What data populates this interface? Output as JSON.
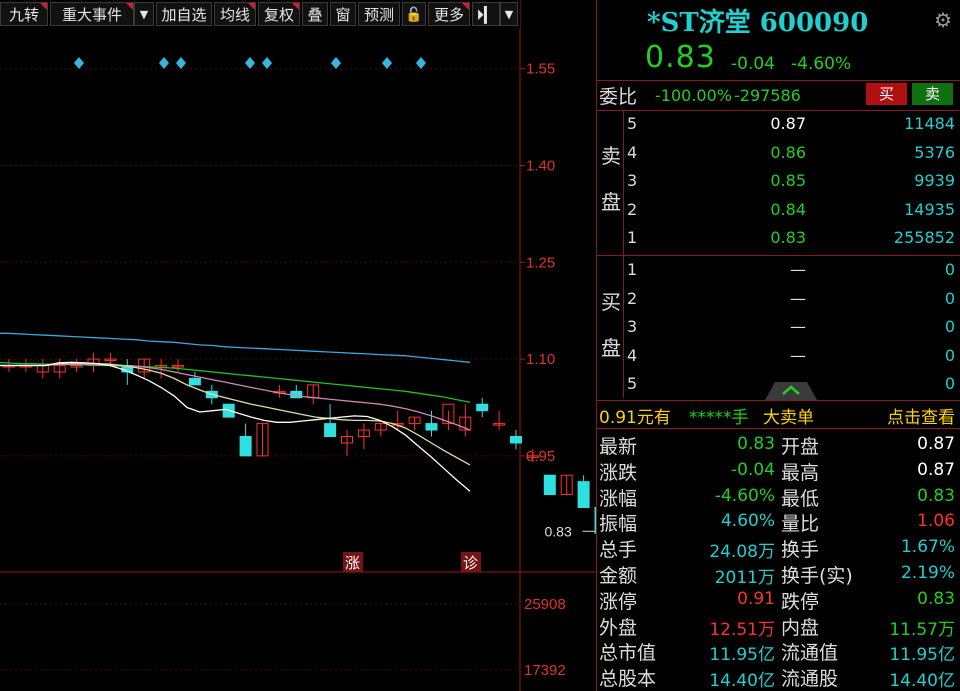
{
  "toolbar": {
    "items": [
      "九转",
      "重大事件",
      "▼",
      "加自选",
      "均线",
      "复权",
      "叠",
      "窗",
      "预测",
      "🔓",
      "更多",
      "⏵▎",
      "▼"
    ]
  },
  "chart": {
    "price_axis": [
      "1.55",
      "1.40",
      "1.25",
      "1.10",
      "0.95"
    ],
    "volume_axis": [
      "25908",
      "17392"
    ],
    "last_price_label": "0.83",
    "badge_up": "涨",
    "badge_diag": "诊"
  },
  "chart_data": {
    "type": "candlestick",
    "ylim": [
      0.77,
      1.61
    ],
    "candles": [
      {
        "o": 1.09,
        "h": 1.1,
        "l": 1.08,
        "c": 1.09
      },
      {
        "o": 1.09,
        "h": 1.1,
        "l": 1.08,
        "c": 1.09
      },
      {
        "o": 1.08,
        "h": 1.1,
        "l": 1.07,
        "c": 1.09
      },
      {
        "o": 1.08,
        "h": 1.1,
        "l": 1.07,
        "c": 1.09
      },
      {
        "o": 1.09,
        "h": 1.1,
        "l": 1.08,
        "c": 1.09
      },
      {
        "o": 1.09,
        "h": 1.11,
        "l": 1.08,
        "c": 1.1
      },
      {
        "o": 1.1,
        "h": 1.11,
        "l": 1.09,
        "c": 1.1
      },
      {
        "o": 1.09,
        "h": 1.1,
        "l": 1.06,
        "c": 1.08
      },
      {
        "o": 1.08,
        "h": 1.1,
        "l": 1.07,
        "c": 1.1
      },
      {
        "o": 1.09,
        "h": 1.1,
        "l": 1.07,
        "c": 1.09
      },
      {
        "o": 1.09,
        "h": 1.1,
        "l": 1.08,
        "c": 1.09
      },
      {
        "o": 1.07,
        "h": 1.08,
        "l": 1.06,
        "c": 1.06
      },
      {
        "o": 1.05,
        "h": 1.06,
        "l": 1.03,
        "c": 1.04
      },
      {
        "o": 1.03,
        "h": 1.03,
        "l": 1.01,
        "c": 1.01
      },
      {
        "o": 0.98,
        "h": 1.0,
        "l": 0.95,
        "c": 0.95
      },
      {
        "o": 0.95,
        "h": 1.0,
        "l": 0.95,
        "c": 1.0
      },
      {
        "o": 1.05,
        "h": 1.06,
        "l": 1.04,
        "c": 1.05
      },
      {
        "o": 1.05,
        "h": 1.06,
        "l": 1.04,
        "c": 1.04
      },
      {
        "o": 1.04,
        "h": 1.06,
        "l": 1.03,
        "c": 1.06
      },
      {
        "o": 1.0,
        "h": 1.03,
        "l": 0.98,
        "c": 0.98
      },
      {
        "o": 0.97,
        "h": 0.99,
        "l": 0.95,
        "c": 0.98
      },
      {
        "o": 0.98,
        "h": 1.0,
        "l": 0.96,
        "c": 0.99
      },
      {
        "o": 0.99,
        "h": 1.0,
        "l": 0.98,
        "c": 1.0
      },
      {
        "o": 1.0,
        "h": 1.02,
        "l": 0.99,
        "c": 1.0
      },
      {
        "o": 1.0,
        "h": 1.01,
        "l": 0.99,
        "c": 1.01
      },
      {
        "o": 1.0,
        "h": 1.02,
        "l": 0.98,
        "c": 0.99
      },
      {
        "o": 1.0,
        "h": 1.02,
        "l": 0.99,
        "c": 1.03
      },
      {
        "o": 0.99,
        "h": 1.03,
        "l": 0.98,
        "c": 1.01
      },
      {
        "o": 1.03,
        "h": 1.04,
        "l": 1.01,
        "c": 1.02
      },
      {
        "o": 1.0,
        "h": 1.02,
        "l": 0.99,
        "c": 1.0
      },
      {
        "o": 0.98,
        "h": 0.99,
        "l": 0.96,
        "c": 0.97
      },
      {
        "o": 0.95,
        "h": 0.96,
        "l": 0.94,
        "c": 0.95
      },
      {
        "o": 0.92,
        "h": 0.92,
        "l": 0.89,
        "c": 0.89
      },
      {
        "o": 0.89,
        "h": 0.92,
        "l": 0.89,
        "c": 0.92
      },
      {
        "o": 0.91,
        "h": 0.92,
        "l": 0.87,
        "c": 0.87
      },
      {
        "o": 0.87,
        "h": 0.87,
        "l": 0.83,
        "c": 0.83
      }
    ],
    "ma": [
      {
        "color": "#3aa7e0",
        "values": [
          1.14,
          1.14,
          1.139,
          1.138,
          1.137,
          1.136,
          1.135,
          1.134,
          1.133,
          1.132,
          1.131,
          1.13,
          1.128,
          1.127,
          1.126,
          1.124,
          1.122,
          1.121,
          1.119,
          1.118,
          1.117,
          1.116,
          1.115,
          1.114,
          1.113,
          1.112,
          1.111,
          1.11,
          1.109,
          1.108,
          1.107,
          1.106,
          1.105,
          1.103,
          1.101,
          1.099,
          1.097,
          1.095
        ]
      },
      {
        "color": "#20c020",
        "values": [
          1.095,
          1.094,
          1.093,
          1.093,
          1.092,
          1.092,
          1.091,
          1.091,
          1.09,
          1.09,
          1.089,
          1.089,
          1.088,
          1.087,
          1.086,
          1.084,
          1.082,
          1.08,
          1.078,
          1.076,
          1.074,
          1.072,
          1.07,
          1.068,
          1.066,
          1.064,
          1.062,
          1.06,
          1.058,
          1.056,
          1.054,
          1.052,
          1.05,
          1.047,
          1.044,
          1.041,
          1.037,
          1.033
        ]
      },
      {
        "color": "#d087b8",
        "values": [
          1.09,
          1.09,
          1.09,
          1.09,
          1.09,
          1.092,
          1.092,
          1.092,
          1.091,
          1.09,
          1.09,
          1.089,
          1.087,
          1.084,
          1.08,
          1.076,
          1.072,
          1.068,
          1.064,
          1.06,
          1.056,
          1.052,
          1.048,
          1.045,
          1.042,
          1.04,
          1.038,
          1.036,
          1.034,
          1.032,
          1.03,
          1.027,
          1.023,
          1.018,
          1.012,
          1.005,
          0.998,
          0.99
        ]
      },
      {
        "color": "#e0e0a0",
        "values": [
          1.09,
          1.09,
          1.09,
          1.09,
          1.09,
          1.093,
          1.094,
          1.094,
          1.093,
          1.092,
          1.09,
          1.087,
          1.083,
          1.078,
          1.07,
          1.06,
          1.052,
          1.045,
          1.04,
          1.035,
          1.03,
          1.026,
          1.022,
          1.018,
          1.014,
          1.01,
          1.008,
          1.006,
          1.005,
          1.005,
          1.004,
          1.0,
          0.993,
          0.982,
          0.97,
          0.958,
          0.947,
          0.936
        ]
      },
      {
        "color": "#ffffff",
        "values": [
          1.09,
          1.09,
          1.09,
          1.09,
          1.09,
          1.094,
          1.095,
          1.094,
          1.093,
          1.09,
          1.084,
          1.076,
          1.067,
          1.056,
          1.043,
          1.025,
          1.018,
          1.02,
          1.022,
          1.016,
          1.01,
          1.005,
          1.002,
          1.002,
          1.004,
          1.006,
          1.008,
          1.01,
          1.012,
          1.011,
          1.005,
          0.995,
          0.982,
          0.965,
          0.948,
          0.93,
          0.912,
          0.895
        ]
      }
    ],
    "volume_ylim": [
      0,
      30000
    ]
  },
  "panel": {
    "stock_name": "*ST济堂 600090",
    "price": "0.83",
    "change": "-0.04",
    "change_pct": "-4.60%",
    "webi_label": "委比",
    "webi_value": "-100.00%",
    "webi_diff": "-297586",
    "buy_label": "买",
    "sell_label": "卖",
    "sell_label_vertical": [
      "卖",
      "盘"
    ],
    "buy_label_vertical": [
      "买",
      "盘"
    ],
    "asks": [
      {
        "level": "5",
        "price": "0.87",
        "vol": "11484"
      },
      {
        "level": "4",
        "price": "0.86",
        "vol": "5376"
      },
      {
        "level": "3",
        "price": "0.85",
        "vol": "9939"
      },
      {
        "level": "2",
        "price": "0.84",
        "vol": "14935"
      },
      {
        "level": "1",
        "price": "0.83",
        "vol": "255852"
      }
    ],
    "bids": [
      {
        "level": "1",
        "price": "—",
        "vol": "0"
      },
      {
        "level": "2",
        "price": "—",
        "vol": "0"
      },
      {
        "level": "3",
        "price": "—",
        "vol": "0"
      },
      {
        "level": "4",
        "price": "—",
        "vol": "0"
      },
      {
        "level": "5",
        "price": "—",
        "vol": "0"
      }
    ],
    "tape": {
      "a": "0.91元有",
      "b": "*****手",
      "c": "大卖单",
      "d": "点击查看"
    },
    "quotes": [
      {
        "l1": "最新",
        "v1": "0.83",
        "c1": "#20d020",
        "l2": "开盘",
        "v2": "0.87",
        "c2": "#ffffff"
      },
      {
        "l1": "涨跌",
        "v1": "-0.04",
        "c1": "#20d020",
        "l2": "最高",
        "v2": "0.87",
        "c2": "#ffffff"
      },
      {
        "l1": "涨幅",
        "v1": "-4.60%",
        "c1": "#20d020",
        "l2": "最低",
        "v2": "0.83",
        "c2": "#20d020"
      },
      {
        "l1": "振幅",
        "v1": "4.60%",
        "c1": "#1fd0d0",
        "l2": "量比",
        "v2": "1.06",
        "c2": "#ff3030"
      },
      {
        "l1": "总手",
        "v1": "24.08万",
        "c1": "#1fd0d0",
        "l2": "换手",
        "v2": "1.67%",
        "c2": "#1fd0d0"
      },
      {
        "l1": "金额",
        "v1": "2011万",
        "c1": "#1fd0d0",
        "l2": "换手(实)",
        "v2": "2.19%",
        "c2": "#1fd0d0"
      },
      {
        "l1": "涨停",
        "v1": "0.91",
        "c1": "#ff3030",
        "l2": "跌停",
        "v2": "0.83",
        "c2": "#20d020"
      },
      {
        "l1": "外盘",
        "v1": "12.51万",
        "c1": "#ff3030",
        "l2": "内盘",
        "v2": "11.57万",
        "c2": "#20d020"
      },
      {
        "l1": "总市值",
        "v1": "11.95亿",
        "c1": "#1fd0d0",
        "l2": "流通值",
        "v2": "11.95亿",
        "c2": "#1fd0d0"
      },
      {
        "l1": "总股本",
        "v1": "14.40亿",
        "c1": "#1fd0d0",
        "l2": "流通股",
        "v2": "14.40亿",
        "c2": "#1fd0d0"
      }
    ]
  }
}
